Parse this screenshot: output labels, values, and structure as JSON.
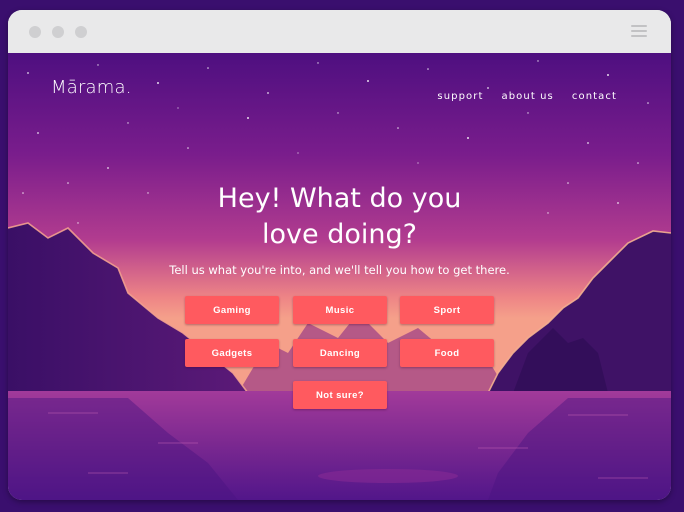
{
  "brand": {
    "logo": "Mārama."
  },
  "nav": {
    "support": "support",
    "about": "about us",
    "contact": "contact"
  },
  "hero": {
    "title_line1": "Hey! What do you",
    "title_line2": "love doing?",
    "subtitle": "Tell us what you're into, and we'll tell you how to get there."
  },
  "options": {
    "gaming": "Gaming",
    "music": "Music",
    "sport": "Sport",
    "gadgets": "Gadgets",
    "dancing": "Dancing",
    "food": "Food",
    "not_sure": "Not sure?"
  },
  "colors": {
    "button": "#ff5a5f",
    "sky_top": "#5a1283",
    "sky_mid": "#9b2b8f",
    "horizon": "#f08a8a",
    "mountain": "#3d1263"
  },
  "icons": {
    "browser_menu": "hamburger-icon"
  }
}
